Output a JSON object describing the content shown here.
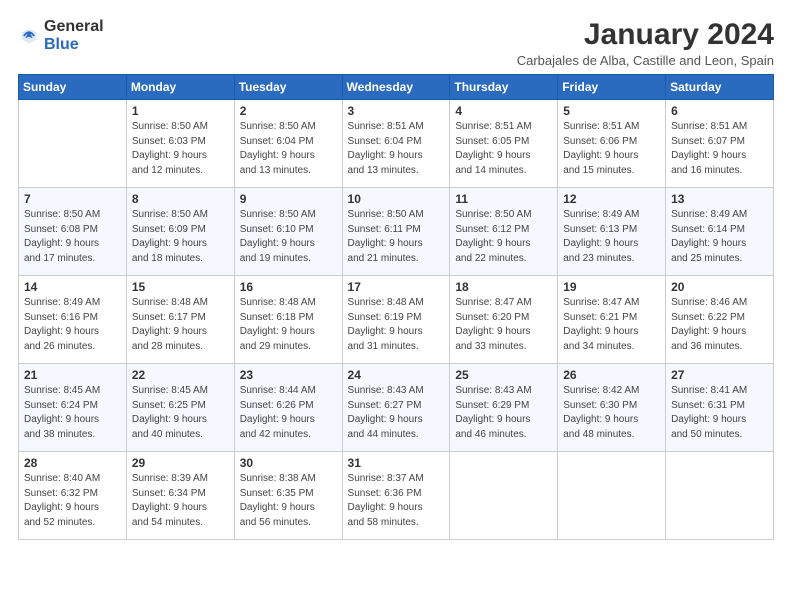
{
  "logo": {
    "general": "General",
    "blue": "Blue"
  },
  "title": "January 2024",
  "subtitle": "Carbajales de Alba, Castille and Leon, Spain",
  "headers": [
    "Sunday",
    "Monday",
    "Tuesday",
    "Wednesday",
    "Thursday",
    "Friday",
    "Saturday"
  ],
  "weeks": [
    [
      {
        "day": "",
        "lines": []
      },
      {
        "day": "1",
        "lines": [
          "Sunrise: 8:50 AM",
          "Sunset: 6:03 PM",
          "Daylight: 9 hours",
          "and 12 minutes."
        ]
      },
      {
        "day": "2",
        "lines": [
          "Sunrise: 8:50 AM",
          "Sunset: 6:04 PM",
          "Daylight: 9 hours",
          "and 13 minutes."
        ]
      },
      {
        "day": "3",
        "lines": [
          "Sunrise: 8:51 AM",
          "Sunset: 6:04 PM",
          "Daylight: 9 hours",
          "and 13 minutes."
        ]
      },
      {
        "day": "4",
        "lines": [
          "Sunrise: 8:51 AM",
          "Sunset: 6:05 PM",
          "Daylight: 9 hours",
          "and 14 minutes."
        ]
      },
      {
        "day": "5",
        "lines": [
          "Sunrise: 8:51 AM",
          "Sunset: 6:06 PM",
          "Daylight: 9 hours",
          "and 15 minutes."
        ]
      },
      {
        "day": "6",
        "lines": [
          "Sunrise: 8:51 AM",
          "Sunset: 6:07 PM",
          "Daylight: 9 hours",
          "and 16 minutes."
        ]
      }
    ],
    [
      {
        "day": "7",
        "lines": [
          "Sunrise: 8:50 AM",
          "Sunset: 6:08 PM",
          "Daylight: 9 hours",
          "and 17 minutes."
        ]
      },
      {
        "day": "8",
        "lines": [
          "Sunrise: 8:50 AM",
          "Sunset: 6:09 PM",
          "Daylight: 9 hours",
          "and 18 minutes."
        ]
      },
      {
        "day": "9",
        "lines": [
          "Sunrise: 8:50 AM",
          "Sunset: 6:10 PM",
          "Daylight: 9 hours",
          "and 19 minutes."
        ]
      },
      {
        "day": "10",
        "lines": [
          "Sunrise: 8:50 AM",
          "Sunset: 6:11 PM",
          "Daylight: 9 hours",
          "and 21 minutes."
        ]
      },
      {
        "day": "11",
        "lines": [
          "Sunrise: 8:50 AM",
          "Sunset: 6:12 PM",
          "Daylight: 9 hours",
          "and 22 minutes."
        ]
      },
      {
        "day": "12",
        "lines": [
          "Sunrise: 8:49 AM",
          "Sunset: 6:13 PM",
          "Daylight: 9 hours",
          "and 23 minutes."
        ]
      },
      {
        "day": "13",
        "lines": [
          "Sunrise: 8:49 AM",
          "Sunset: 6:14 PM",
          "Daylight: 9 hours",
          "and 25 minutes."
        ]
      }
    ],
    [
      {
        "day": "14",
        "lines": [
          "Sunrise: 8:49 AM",
          "Sunset: 6:16 PM",
          "Daylight: 9 hours",
          "and 26 minutes."
        ]
      },
      {
        "day": "15",
        "lines": [
          "Sunrise: 8:48 AM",
          "Sunset: 6:17 PM",
          "Daylight: 9 hours",
          "and 28 minutes."
        ]
      },
      {
        "day": "16",
        "lines": [
          "Sunrise: 8:48 AM",
          "Sunset: 6:18 PM",
          "Daylight: 9 hours",
          "and 29 minutes."
        ]
      },
      {
        "day": "17",
        "lines": [
          "Sunrise: 8:48 AM",
          "Sunset: 6:19 PM",
          "Daylight: 9 hours",
          "and 31 minutes."
        ]
      },
      {
        "day": "18",
        "lines": [
          "Sunrise: 8:47 AM",
          "Sunset: 6:20 PM",
          "Daylight: 9 hours",
          "and 33 minutes."
        ]
      },
      {
        "day": "19",
        "lines": [
          "Sunrise: 8:47 AM",
          "Sunset: 6:21 PM",
          "Daylight: 9 hours",
          "and 34 minutes."
        ]
      },
      {
        "day": "20",
        "lines": [
          "Sunrise: 8:46 AM",
          "Sunset: 6:22 PM",
          "Daylight: 9 hours",
          "and 36 minutes."
        ]
      }
    ],
    [
      {
        "day": "21",
        "lines": [
          "Sunrise: 8:45 AM",
          "Sunset: 6:24 PM",
          "Daylight: 9 hours",
          "and 38 minutes."
        ]
      },
      {
        "day": "22",
        "lines": [
          "Sunrise: 8:45 AM",
          "Sunset: 6:25 PM",
          "Daylight: 9 hours",
          "and 40 minutes."
        ]
      },
      {
        "day": "23",
        "lines": [
          "Sunrise: 8:44 AM",
          "Sunset: 6:26 PM",
          "Daylight: 9 hours",
          "and 42 minutes."
        ]
      },
      {
        "day": "24",
        "lines": [
          "Sunrise: 8:43 AM",
          "Sunset: 6:27 PM",
          "Daylight: 9 hours",
          "and 44 minutes."
        ]
      },
      {
        "day": "25",
        "lines": [
          "Sunrise: 8:43 AM",
          "Sunset: 6:29 PM",
          "Daylight: 9 hours",
          "and 46 minutes."
        ]
      },
      {
        "day": "26",
        "lines": [
          "Sunrise: 8:42 AM",
          "Sunset: 6:30 PM",
          "Daylight: 9 hours",
          "and 48 minutes."
        ]
      },
      {
        "day": "27",
        "lines": [
          "Sunrise: 8:41 AM",
          "Sunset: 6:31 PM",
          "Daylight: 9 hours",
          "and 50 minutes."
        ]
      }
    ],
    [
      {
        "day": "28",
        "lines": [
          "Sunrise: 8:40 AM",
          "Sunset: 6:32 PM",
          "Daylight: 9 hours",
          "and 52 minutes."
        ]
      },
      {
        "day": "29",
        "lines": [
          "Sunrise: 8:39 AM",
          "Sunset: 6:34 PM",
          "Daylight: 9 hours",
          "and 54 minutes."
        ]
      },
      {
        "day": "30",
        "lines": [
          "Sunrise: 8:38 AM",
          "Sunset: 6:35 PM",
          "Daylight: 9 hours",
          "and 56 minutes."
        ]
      },
      {
        "day": "31",
        "lines": [
          "Sunrise: 8:37 AM",
          "Sunset: 6:36 PM",
          "Daylight: 9 hours",
          "and 58 minutes."
        ]
      },
      {
        "day": "",
        "lines": []
      },
      {
        "day": "",
        "lines": []
      },
      {
        "day": "",
        "lines": []
      }
    ]
  ]
}
